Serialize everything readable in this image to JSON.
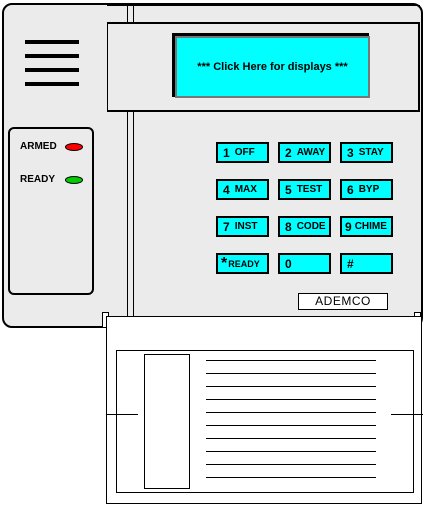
{
  "display": {
    "text": "*** Click Here for displays ***"
  },
  "indicators": [
    {
      "label": "ARMED",
      "color": "#ff0000"
    },
    {
      "label": "READY",
      "color": "#00cc00"
    }
  ],
  "keys": [
    {
      "num": "1",
      "fn": "OFF"
    },
    {
      "num": "2",
      "fn": "AWAY"
    },
    {
      "num": "3",
      "fn": "STAY"
    },
    {
      "num": "4",
      "fn": "MAX"
    },
    {
      "num": "5",
      "fn": "TEST"
    },
    {
      "num": "6",
      "fn": "BYP"
    },
    {
      "num": "7",
      "fn": "INST"
    },
    {
      "num": "8",
      "fn": "CODE"
    },
    {
      "num": "9",
      "fn": "CHIME"
    },
    {
      "num": "*",
      "fn": "READY"
    },
    {
      "num": "0",
      "fn": ""
    },
    {
      "num": "#",
      "fn": ""
    }
  ],
  "brand": "ADEMCO",
  "colors": {
    "key": "#00ffff",
    "panel": "#ebebeb",
    "armed_led": "#ff0000",
    "ready_led": "#00cc00"
  }
}
